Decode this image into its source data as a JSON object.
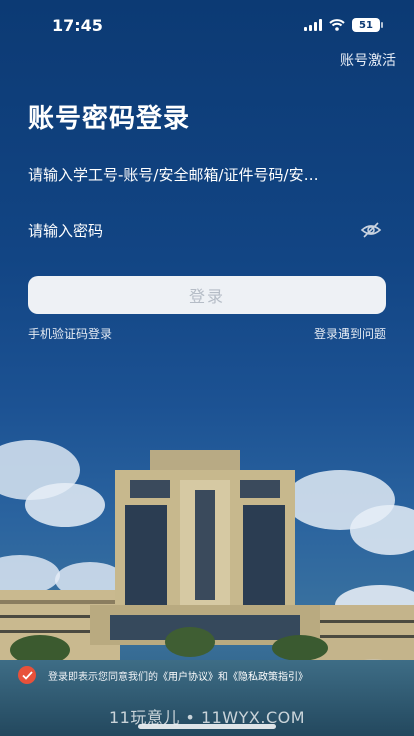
{
  "status_bar": {
    "time": "17:45",
    "battery": "51"
  },
  "header": {
    "activate_link": "账号激活"
  },
  "login": {
    "title": "账号密码登录",
    "account_placeholder": "请输入学工号-账号/安全邮箱/证件号码/安…",
    "password_placeholder": "请输入密码",
    "login_button": "登录",
    "sms_login": "手机验证码登录",
    "problem_link": "登录遇到问题"
  },
  "agreement": {
    "prefix": "登录即表示您同意我们的",
    "user_agreement": "《用户协议》",
    "and": "和",
    "privacy_policy": "《隐私政策指引》"
  },
  "watermark": "11玩意儿 • 11WYX.COM",
  "colors": {
    "background_top": "#0c3a74",
    "accent": "#e8513a",
    "button_bg": "#eef1f5",
    "button_text": "#b5bcc6"
  },
  "icons": [
    "signal-icon",
    "wifi-icon",
    "battery-icon",
    "eye-off-icon",
    "check-icon"
  ]
}
